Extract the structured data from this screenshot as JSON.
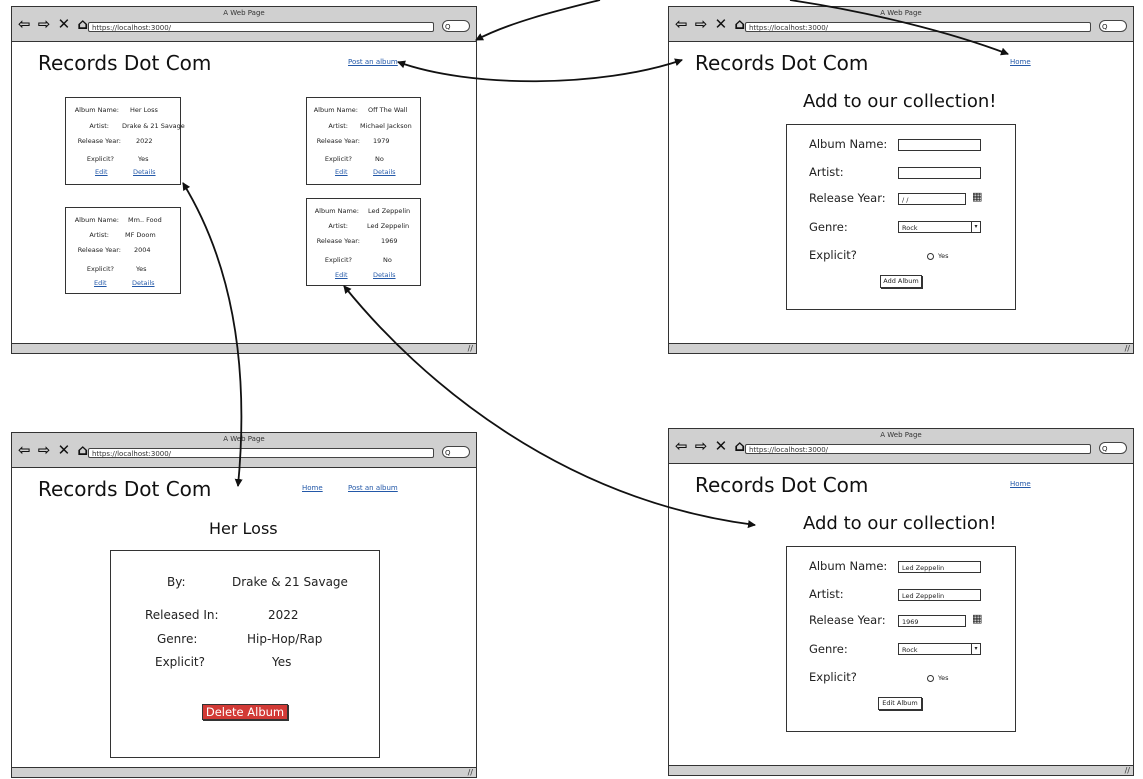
{
  "browser": {
    "window_title": "A Web Page",
    "url": "https://localhost:3000/",
    "nav_icons": "⇦ ⇨ ✕ ⌂",
    "search_glyph": "Q",
    "resize_glyph": "//"
  },
  "site_title": "Records Dot Com",
  "links": {
    "post_album": "Post an album",
    "home": "Home"
  },
  "home": {
    "cards": [
      {
        "album_name_label": "Album Name:",
        "album_name": "Her Loss",
        "artist_label": "Artist:",
        "artist": "Drake & 21 Savage",
        "year_label": "Release Year:",
        "year": "2022",
        "explicit_label": "Explicit?",
        "explicit": "Yes",
        "edit": "Edit",
        "details": "Details"
      },
      {
        "album_name_label": "Album Name:",
        "album_name": "Mm.. Food",
        "artist_label": "Artist:",
        "artist": "MF Doom",
        "year_label": "Release Year:",
        "year": "2004",
        "explicit_label": "Explicit?",
        "explicit": "Yes",
        "edit": "Edit",
        "details": "Details"
      },
      {
        "album_name_label": "Album Name:",
        "album_name": "Off The Wall",
        "artist_label": "Artist:",
        "artist": "Michael Jackson",
        "year_label": "Release Year:",
        "year": "1979",
        "explicit_label": "Explicit?",
        "explicit": "No",
        "edit": "Edit",
        "details": "Details"
      },
      {
        "album_name_label": "Album Name:",
        "album_name": "Led Zeppelin",
        "artist_label": "Artist:",
        "artist": "Led Zeppelin",
        "year_label": "Release Year:",
        "year": "1969",
        "explicit_label": "Explicit?",
        "explicit": "No",
        "edit": "Edit",
        "details": "Details"
      }
    ]
  },
  "add_form": {
    "heading": "Add to our collection!",
    "album_name_label": "Album Name:",
    "artist_label": "Artist:",
    "year_label": "Release Year:",
    "genre_label": "Genre:",
    "explicit_label": "Explicit?",
    "album_name_value": "",
    "artist_value": "",
    "year_value": "/ /",
    "genre_value": "Rock",
    "explicit_option": "Yes",
    "submit": "Add Album",
    "calendar_icon": "▦",
    "dropdown_icon": "▾"
  },
  "edit_form": {
    "heading": "Add to our collection!",
    "album_name_label": "Album Name:",
    "artist_label": "Artist:",
    "year_label": "Release Year:",
    "genre_label": "Genre:",
    "explicit_label": "Explicit?",
    "album_name_value": "Led Zeppelin",
    "artist_value": "Led Zeppelin",
    "year_value": "1969",
    "genre_value": "Rock",
    "explicit_option": "Yes",
    "submit": "Edit Album"
  },
  "details": {
    "title": "Her Loss",
    "by_label": "By:",
    "by": "Drake & 21 Savage",
    "released_label": "Released In:",
    "released": "2022",
    "genre_label": "Genre:",
    "genre": "Hip-Hop/Rap",
    "explicit_label": "Explicit?",
    "explicit": "Yes",
    "delete": "Delete Album",
    "delete_color": "#d23a36"
  }
}
